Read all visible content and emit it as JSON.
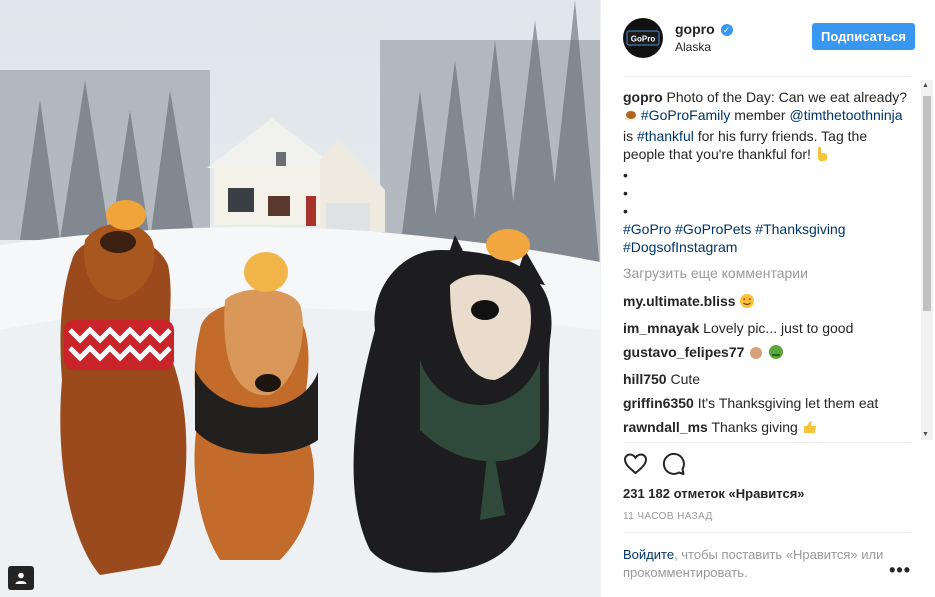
{
  "post": {
    "username": "gopro",
    "location": "Alaska",
    "follow_label": "Подписаться",
    "caption": {
      "username": "gopro",
      "text1": "Photo of the Day: Can we eat already?",
      "tag_family": "#GoProFamily",
      "text2": "member",
      "mention": "@timthetoothninja",
      "text3": "is",
      "tag_thankful": "#thankful",
      "text4": "for his furry friends. Tag the people that you're thankful for!",
      "dot": "•",
      "tags_line1": "#GoPro #GoProPets #Thanksgiving",
      "tags_line2": "#DogsofInstagram"
    },
    "load_more": "Загрузить еще комментарии",
    "comments": [
      {
        "user": "my.ultimate.bliss",
        "text": ""
      },
      {
        "user": "im_mnayak",
        "text": "Lovely pic... just to good"
      },
      {
        "user": "gustavo_felipes77",
        "text": ""
      },
      {
        "user": "hill750",
        "text": "Cute"
      },
      {
        "user": "griffin6350",
        "text": "It's Thanksgiving let them eat"
      },
      {
        "user": "rawndall_ms",
        "text": "Thanks giving"
      }
    ],
    "likes": "231 182 отметок «Нравится»",
    "time": "11 ЧАСОВ НАЗАД",
    "login_link": "Войдите",
    "login_rest": ", чтобы поставить «Нравится» или прокомментировать.",
    "more_options": "•••"
  },
  "icons": [
    "gopro-logo-icon",
    "verified-icon",
    "heart-icon",
    "comment-icon",
    "user-tag-icon",
    "more-options-icon"
  ],
  "colors": {
    "accent": "#3897f0",
    "link": "#003569",
    "muted": "#999999"
  }
}
